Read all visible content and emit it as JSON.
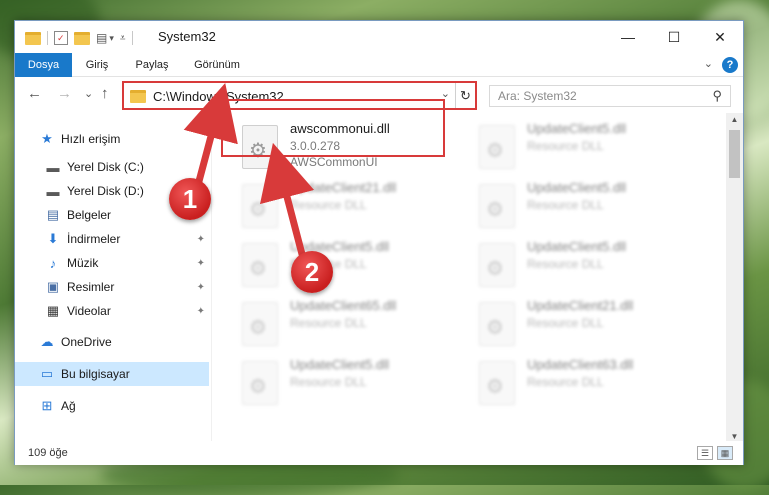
{
  "window": {
    "title": "System32",
    "controls": {
      "minimize": "—",
      "maximize": "☐",
      "close": "✕"
    }
  },
  "ribbon": {
    "tabs": [
      {
        "label": "Dosya",
        "active": true
      },
      {
        "label": "Giriş"
      },
      {
        "label": "Paylaş"
      },
      {
        "label": "Görünüm"
      }
    ],
    "help": "?"
  },
  "nav": {
    "back_icon": "←",
    "forward_icon": "→",
    "recent_icon": "⌄",
    "up_icon": "↑",
    "address": "C:\\Windows\\System32",
    "search_placeholder": "Ara: System32"
  },
  "sidebar": {
    "items": [
      {
        "label": "Hızlı erişim",
        "icon": "star-icon",
        "glyph": "★",
        "color": "#2a7ad6"
      },
      {
        "label": "Yerel Disk (C:)",
        "icon": "drive-icon",
        "glyph": "▬",
        "color": "#5a5a5a"
      },
      {
        "label": "Yerel Disk (D:)",
        "icon": "drive-icon",
        "glyph": "▬",
        "color": "#5a5a5a"
      },
      {
        "label": "Belgeler",
        "icon": "documents-icon",
        "glyph": "▤",
        "color": "#4a6fa5"
      },
      {
        "label": "İndirmeler",
        "icon": "downloads-icon",
        "glyph": "⬇",
        "color": "#2a7ad6",
        "pinned": true
      },
      {
        "label": "Müzik",
        "icon": "music-icon",
        "glyph": "♪",
        "color": "#2a7ad6",
        "pinned": true
      },
      {
        "label": "Resimler",
        "icon": "pictures-icon",
        "glyph": "▣",
        "color": "#4a6fa5",
        "pinned": true
      },
      {
        "label": "Videolar",
        "icon": "videos-icon",
        "glyph": "▦",
        "color": "#3a3a3a",
        "pinned": true
      },
      {
        "label": "OneDrive",
        "icon": "cloud-icon",
        "glyph": "☁",
        "color": "#2a7ad6"
      },
      {
        "label": "Bu bilgisayar",
        "icon": "computer-icon",
        "glyph": "▭",
        "color": "#2a7ad6",
        "selected": true
      },
      {
        "label": "Ağ",
        "icon": "network-icon",
        "glyph": "⊞",
        "color": "#2a7ad6"
      }
    ]
  },
  "files": [
    {
      "name": "awscommonui.dll",
      "version": "3.0.0.278",
      "description": "AWSCommonUI",
      "highlighted": true
    },
    {
      "name": "UpdateClient5.dll",
      "version": "",
      "description": "Resource DLL",
      "blurred": true
    },
    {
      "name": "UpdateClient21.dll",
      "version": "",
      "description": "Resource DLL",
      "blurred": true
    },
    {
      "name": "UpdateClient5.dll",
      "version": "",
      "description": "Resource DLL",
      "blurred": true
    },
    {
      "name": "UpdateClient5.dll",
      "version": "",
      "description": "Resource DLL",
      "blurred": true
    },
    {
      "name": "UpdateClient5.dll",
      "version": "",
      "description": "Resource DLL",
      "blurred": true
    },
    {
      "name": "UpdateClient65.dll",
      "version": "",
      "description": "Resource DLL",
      "blurred": true
    },
    {
      "name": "UpdateClient21.dll",
      "version": "",
      "description": "Resource DLL",
      "blurred": true
    },
    {
      "name": "UpdateClient5.dll",
      "version": "",
      "description": "Resource DLL",
      "blurred": true
    },
    {
      "name": "UpdateClient63.dll",
      "version": "",
      "description": "Resource DLL",
      "blurred": true
    }
  ],
  "status": {
    "item_count": "109 öğe"
  },
  "annotations": {
    "callout_1": "1",
    "callout_2": "2",
    "color": "#d83a3a"
  }
}
